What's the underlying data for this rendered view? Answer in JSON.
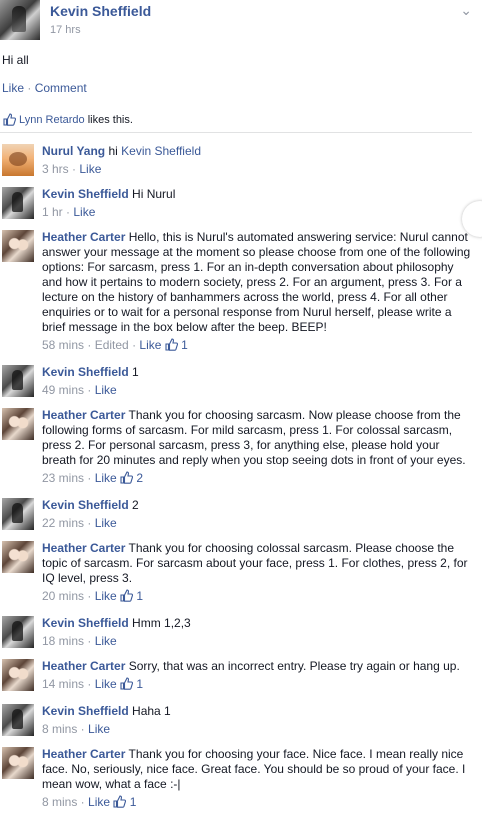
{
  "post": {
    "author": "Kevin Sheffield",
    "time": "17 hrs",
    "text": "Hi all",
    "action_like": "Like",
    "action_sep": "·",
    "action_comment": "Comment",
    "liker": "Lynn Retardo",
    "likes_suffix": " likes this."
  },
  "icons": {
    "thumb": "thumbs-up-icon",
    "chevron": "chevron-down-icon"
  },
  "colors": {
    "link": "#3b5998",
    "meta": "#9197a3"
  },
  "comments": [
    {
      "author": "Nurul Yang",
      "avatar": "nurul",
      "text": "hi ",
      "mention": "Kevin Sheffield",
      "time": "3 hrs",
      "edited": "",
      "like": "Like",
      "likes": ""
    },
    {
      "author": "Kevin Sheffield",
      "avatar": "kevin",
      "text": "Hi Nurul",
      "mention": "",
      "time": "1 hr",
      "edited": "",
      "like": "Like",
      "likes": ""
    },
    {
      "author": "Heather Carter",
      "avatar": "heather",
      "text": "Hello, this is Nurul's automated answering service: Nurul cannot answer your message at the moment so please choose from one of the following options: For sarcasm, press 1. For an in-depth conversation about philosophy and how it pertains to modern society, press 2. For an argument, press 3. For a lecture on the history of banhammers across the world, press 4. For all other enquiries or to wait for a personal response from Nurul herself, please write a brief message in the box below after the beep. BEEP!",
      "mention": "",
      "time": "58 mins",
      "edited": "Edited",
      "like": "Like",
      "likes": "1"
    },
    {
      "author": "Kevin Sheffield",
      "avatar": "kevin",
      "text": "1",
      "mention": "",
      "time": "49 mins",
      "edited": "",
      "like": "Like",
      "likes": ""
    },
    {
      "author": "Heather Carter",
      "avatar": "heather",
      "text": "Thank you for choosing sarcasm. Now please choose from the following forms of sarcasm. For mild sarcasm, press 1. For colossal sarcasm, press 2. For personal sarcasm, press 3, for anything else, please hold your breath for 20 minutes and reply when you stop seeing dots in front of your eyes.",
      "mention": "",
      "time": "23 mins",
      "edited": "",
      "like": "Like",
      "likes": "2"
    },
    {
      "author": "Kevin Sheffield",
      "avatar": "kevin",
      "text": "2",
      "mention": "",
      "time": "22 mins",
      "edited": "",
      "like": "Like",
      "likes": ""
    },
    {
      "author": "Heather Carter",
      "avatar": "heather",
      "text": "Thank you for choosing colossal sarcasm. Please choose the topic of sarcasm. For sarcasm about your face, press 1. For clothes, press 2, for IQ level, press 3.",
      "mention": "",
      "time": "20 mins",
      "edited": "",
      "like": "Like",
      "likes": "1"
    },
    {
      "author": "Kevin Sheffield",
      "avatar": "kevin",
      "text": "Hmm 1,2,3",
      "mention": "",
      "time": "18 mins",
      "edited": "",
      "like": "Like",
      "likes": ""
    },
    {
      "author": "Heather Carter",
      "avatar": "heather",
      "text": "Sorry, that was an incorrect entry. Please try again or hang up.",
      "mention": "",
      "time": "14 mins",
      "edited": "",
      "like": "Like",
      "likes": "1"
    },
    {
      "author": "Kevin Sheffield",
      "avatar": "kevin",
      "text": "Haha 1",
      "mention": "",
      "time": "8 mins",
      "edited": "",
      "like": "Like",
      "likes": ""
    },
    {
      "author": "Heather Carter",
      "avatar": "heather",
      "text": "Thank you for choosing your face. Nice face. I mean really nice face. No, seriously, nice face. Great face. You should be so proud of your face. I mean wow, what a face :-|",
      "mention": "",
      "time": "8 mins",
      "edited": "",
      "like": "Like",
      "likes": "1"
    }
  ]
}
